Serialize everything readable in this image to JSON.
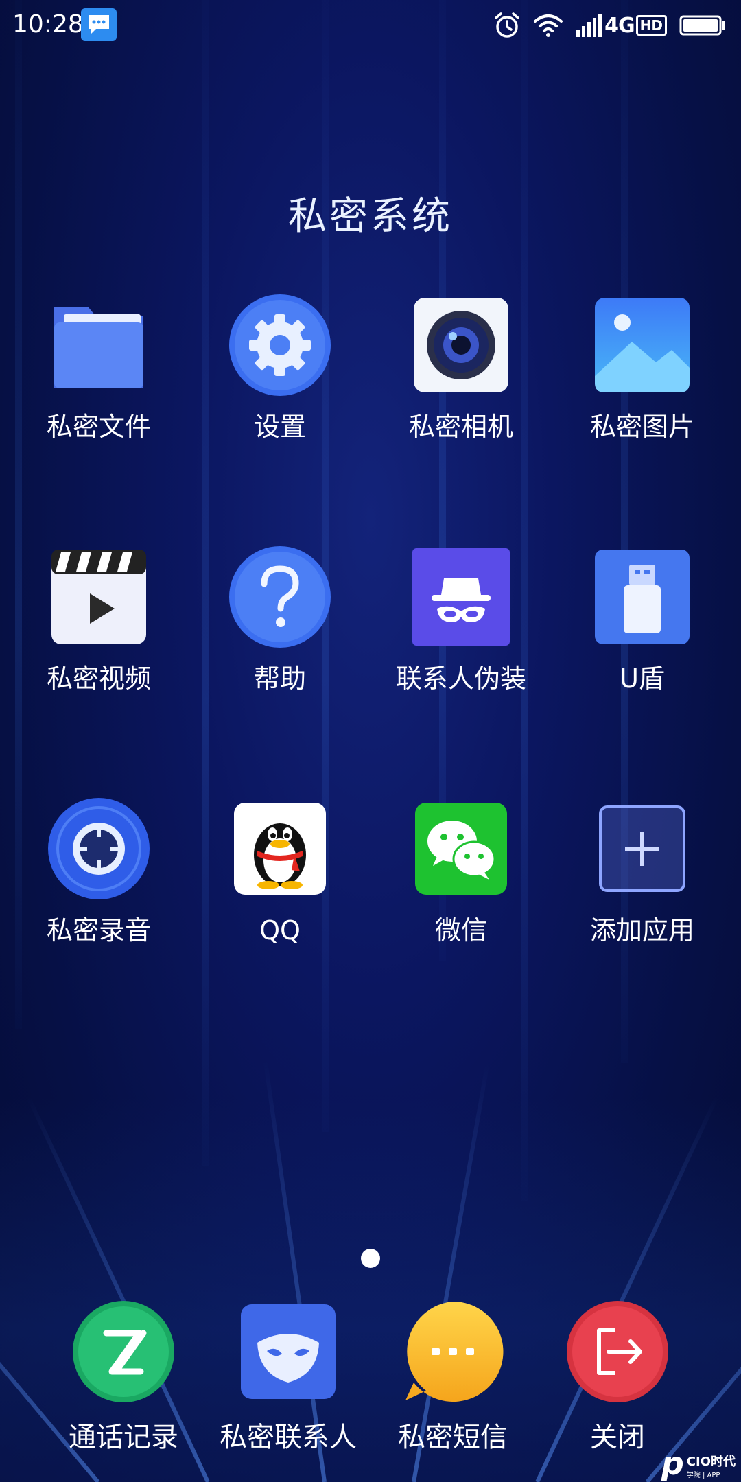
{
  "status_bar": {
    "time": "10:28",
    "network": "4G",
    "hd": "HD"
  },
  "folder": {
    "title": "私密系统"
  },
  "apps": [
    {
      "label": "私密文件",
      "icon": "folder-icon"
    },
    {
      "label": "设置",
      "icon": "gear-icon"
    },
    {
      "label": "私密相机",
      "icon": "camera-icon"
    },
    {
      "label": "私密图片",
      "icon": "picture-icon"
    },
    {
      "label": "私密视频",
      "icon": "video-icon"
    },
    {
      "label": "帮助",
      "icon": "help-icon"
    },
    {
      "label": "联系人伪装",
      "icon": "incognito-icon"
    },
    {
      "label": "U盾",
      "icon": "usb-icon"
    },
    {
      "label": "私密录音",
      "icon": "recorder-icon"
    },
    {
      "label": "QQ",
      "icon": "qq-penguin-icon"
    },
    {
      "label": "微信",
      "icon": "wechat-icon"
    },
    {
      "label": "添加应用",
      "icon": "add-icon"
    }
  ],
  "dock": [
    {
      "label": "通话记录",
      "icon": "call-log-icon"
    },
    {
      "label": "私密联系人",
      "icon": "mask-icon"
    },
    {
      "label": "私密短信",
      "icon": "sms-bubble-icon"
    },
    {
      "label": "关闭",
      "icon": "exit-icon"
    }
  ],
  "watermark": {
    "brand": "CIO时代",
    "sub": "学院 | APP"
  }
}
